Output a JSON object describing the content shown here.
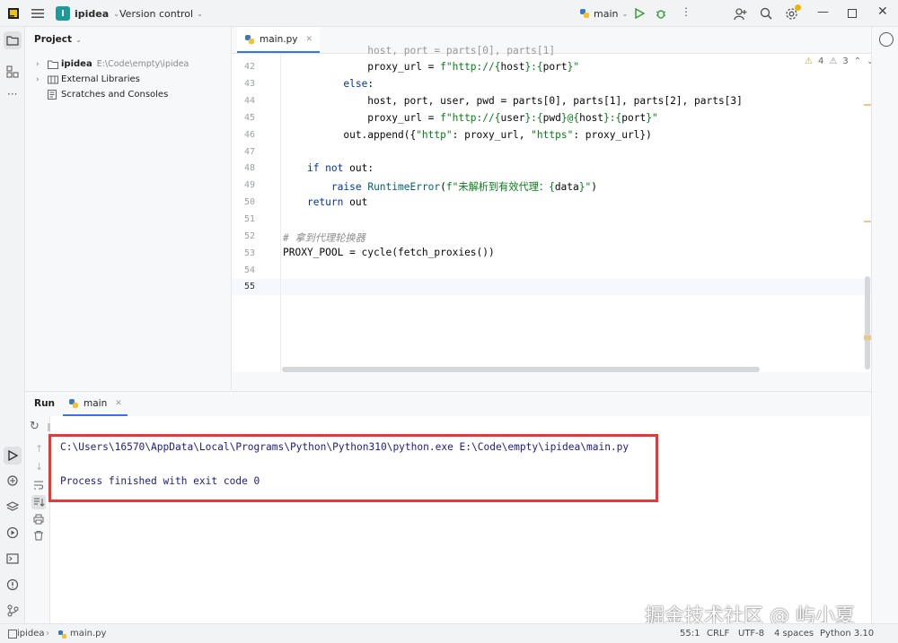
{
  "titlebar": {
    "project_badge": "I",
    "project_name": "ipidea",
    "vcs": "Version control",
    "run_config": "main"
  },
  "project_panel": {
    "title": "Project",
    "items": [
      {
        "label": "ipidea",
        "path": "E:\\Code\\empty\\ipidea"
      },
      {
        "label": "External Libraries"
      },
      {
        "label": "Scratches and Consoles"
      }
    ]
  },
  "editor": {
    "tab": "main.py",
    "inspections": {
      "warnings": "4",
      "weak": "3"
    },
    "line_numbers": [
      "42",
      "43",
      "44",
      "45",
      "46",
      "47",
      "48",
      "49",
      "50",
      "51",
      "52",
      "53",
      "54",
      "55"
    ]
  },
  "run_panel": {
    "title": "Run",
    "tab": "main",
    "output": [
      "C:\\Users\\16570\\AppData\\Local\\Programs\\Python\\Python310\\python.exe E:\\Code\\empty\\ipidea\\main.py",
      "",
      "Process finished with exit code 0"
    ],
    "highlight_color": "#e53935"
  },
  "statusbar": {
    "crumb_project": "ipidea",
    "crumb_file": "main.py",
    "position": "55:1",
    "line_sep": "CRLF",
    "encoding": "UTF-8",
    "indent": "4 spaces",
    "interpreter": "Python 3.10"
  },
  "watermark": "掘金技术社区 @ 屿小夏"
}
